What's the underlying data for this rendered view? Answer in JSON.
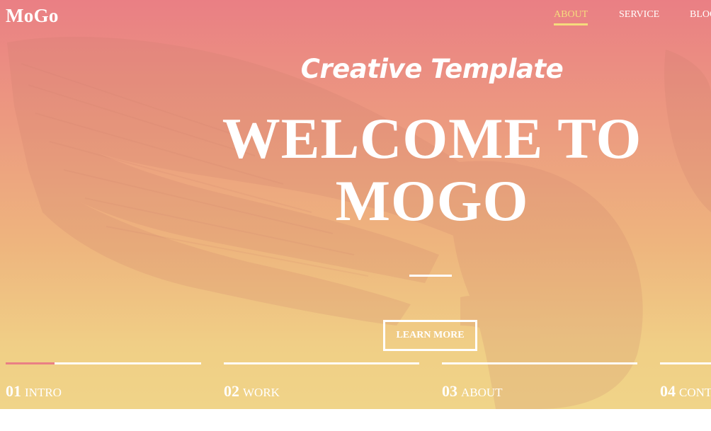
{
  "brand": {
    "logo": "MoGo"
  },
  "nav": {
    "items": [
      {
        "label": "ABOUT",
        "active": true
      },
      {
        "label": "SERVICE",
        "active": false
      },
      {
        "label": "BLOG",
        "active": false
      }
    ]
  },
  "hero": {
    "subtitle": "Creative Template",
    "title_line1": "WELCOME TO",
    "title_line2": "MOGO",
    "cta_label": "LEARN MORE"
  },
  "slider": {
    "items": [
      {
        "number": "01",
        "label": "INTRO",
        "progress": 0.25
      },
      {
        "number": "02",
        "label": "WORK",
        "progress": 0
      },
      {
        "number": "03",
        "label": "ABOUT",
        "progress": 0
      },
      {
        "number": "04",
        "label": "CONTACTS",
        "progress": 0
      }
    ]
  },
  "colors": {
    "gradient_top": "#ea7f84",
    "gradient_bottom": "#f0d488",
    "accent": "#f5dc7d",
    "progress": "#ea7f84",
    "text": "#ffffff"
  },
  "icons": {
    "background": "eagle-silhouette"
  }
}
